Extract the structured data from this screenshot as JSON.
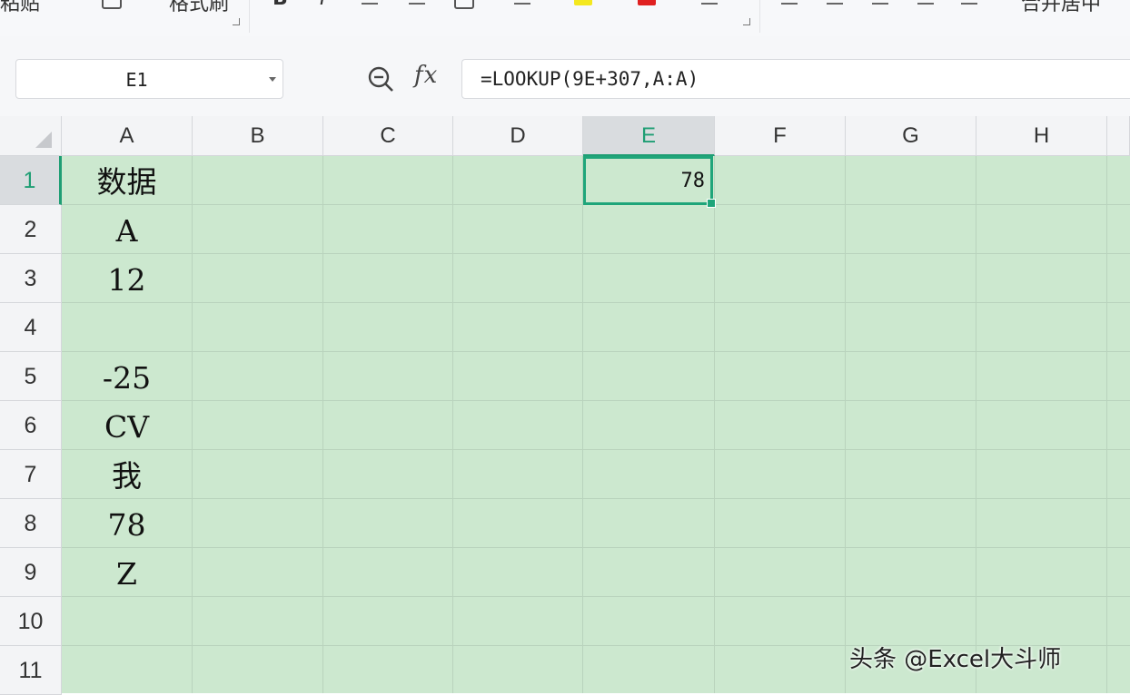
{
  "ribbon": {
    "text_left": "粘贴",
    "text_format_painter": "格式刷",
    "text_bold": "B",
    "text_italic": "I",
    "text_merge": "合并居中"
  },
  "name_box": {
    "value": "E1"
  },
  "formula_bar": {
    "fx_label": "fx",
    "formula": "=LOOKUP(9E+307,A:A)"
  },
  "sheet": {
    "columns": [
      "A",
      "B",
      "C",
      "D",
      "E",
      "F",
      "G",
      "H"
    ],
    "rows": [
      "1",
      "2",
      "3",
      "4",
      "5",
      "6",
      "7",
      "8",
      "9",
      "10",
      "11"
    ],
    "selected_cell": "E1",
    "column_A": [
      "数据",
      "A",
      "12",
      "",
      "-25",
      "CV",
      "我",
      "78",
      "Z",
      "",
      ""
    ],
    "E1_value": "78"
  },
  "colors": {
    "cell_fill": "#cce8cf",
    "selection": "#1fa57a"
  },
  "watermark": "头条 @Excel大斗师"
}
